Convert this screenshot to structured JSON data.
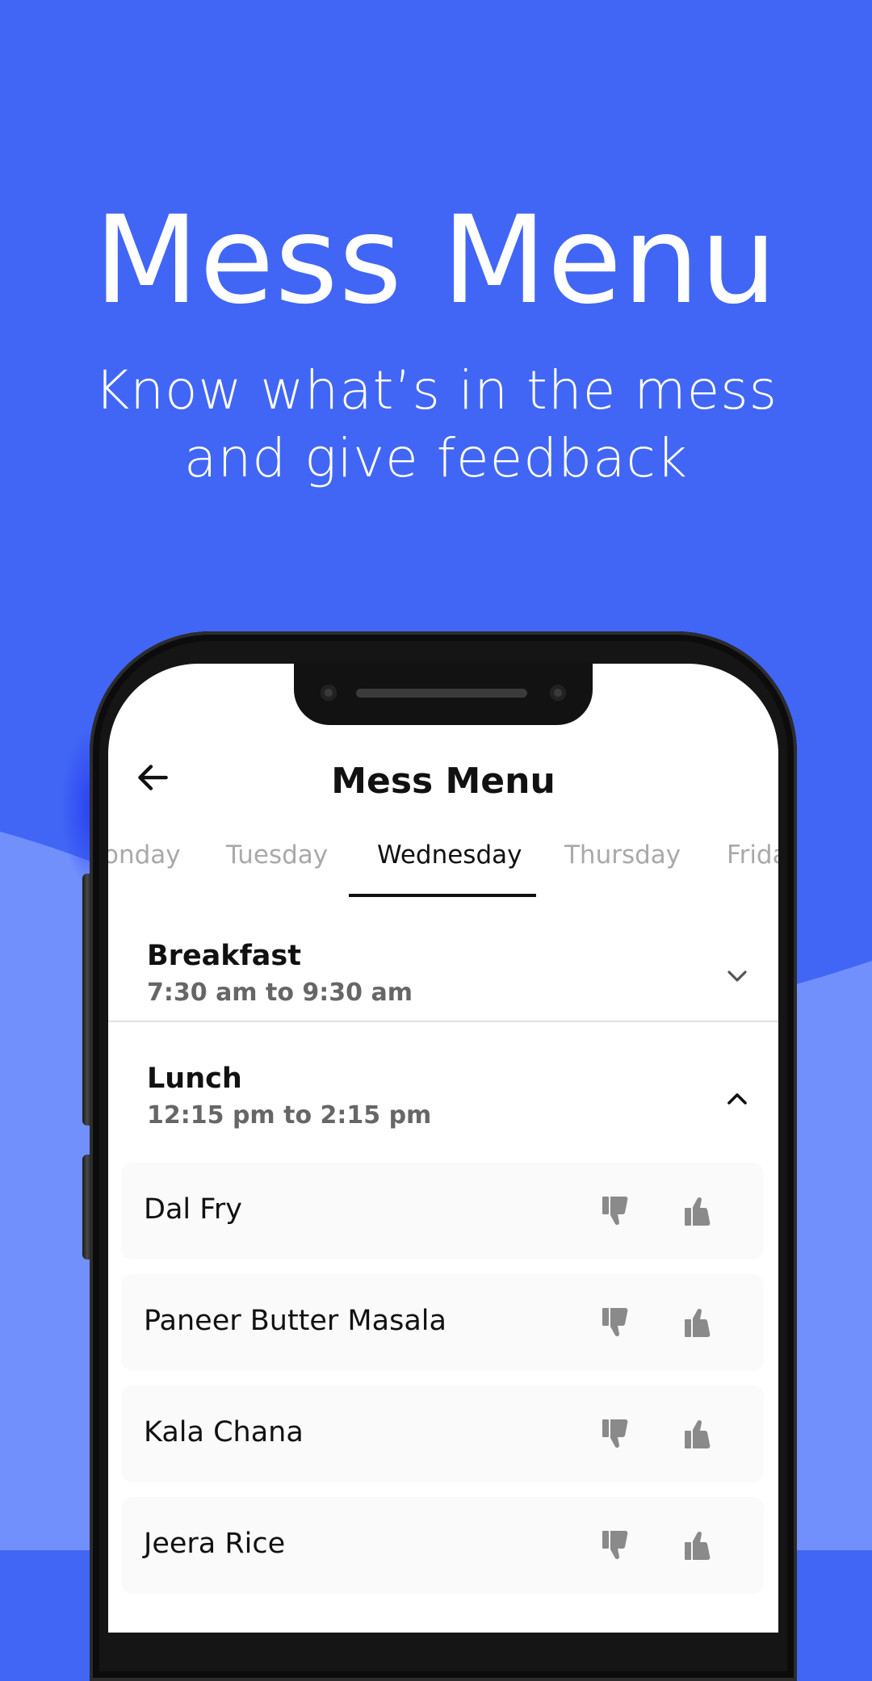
{
  "hero": {
    "title": "Mess Menu",
    "subtitle_line1": "Know what’s in the mess",
    "subtitle_line2": "and give feedback"
  },
  "colors": {
    "background": "#4166f5",
    "wave": "#7190fc",
    "phone_frame": "#151515",
    "active_text": "#111111",
    "inactive_tab": "#a9a9a9",
    "vote_icon": "#8a8a8a"
  },
  "app": {
    "title": "Mess Menu",
    "back_icon": "arrow-left-icon",
    "tabs": [
      {
        "label": "Monday",
        "visible_text": "onday"
      },
      {
        "label": "Tuesday",
        "visible_text": "Tuesday"
      },
      {
        "label": "Wednesday",
        "visible_text": "Wednesday",
        "active": true
      },
      {
        "label": "Thursday",
        "visible_text": "Thursday"
      },
      {
        "label": "Friday",
        "visible_text": "Frida"
      }
    ],
    "meals": [
      {
        "name": "Breakfast",
        "time": "7:30 am to 9:30 am",
        "expanded": false,
        "toggle_icon": "chevron-down-icon"
      },
      {
        "name": "Lunch",
        "time": "12:15 pm to 2:15 pm",
        "expanded": true,
        "toggle_icon": "chevron-up-icon"
      }
    ],
    "lunch_items": [
      {
        "name": "Dal Fry"
      },
      {
        "name": "Paneer Butter Masala"
      },
      {
        "name": "Kala Chana"
      },
      {
        "name": "Jeera Rice"
      }
    ],
    "vote_icons": {
      "dislike": "thumbs-down-icon",
      "like": "thumbs-up-icon"
    }
  }
}
